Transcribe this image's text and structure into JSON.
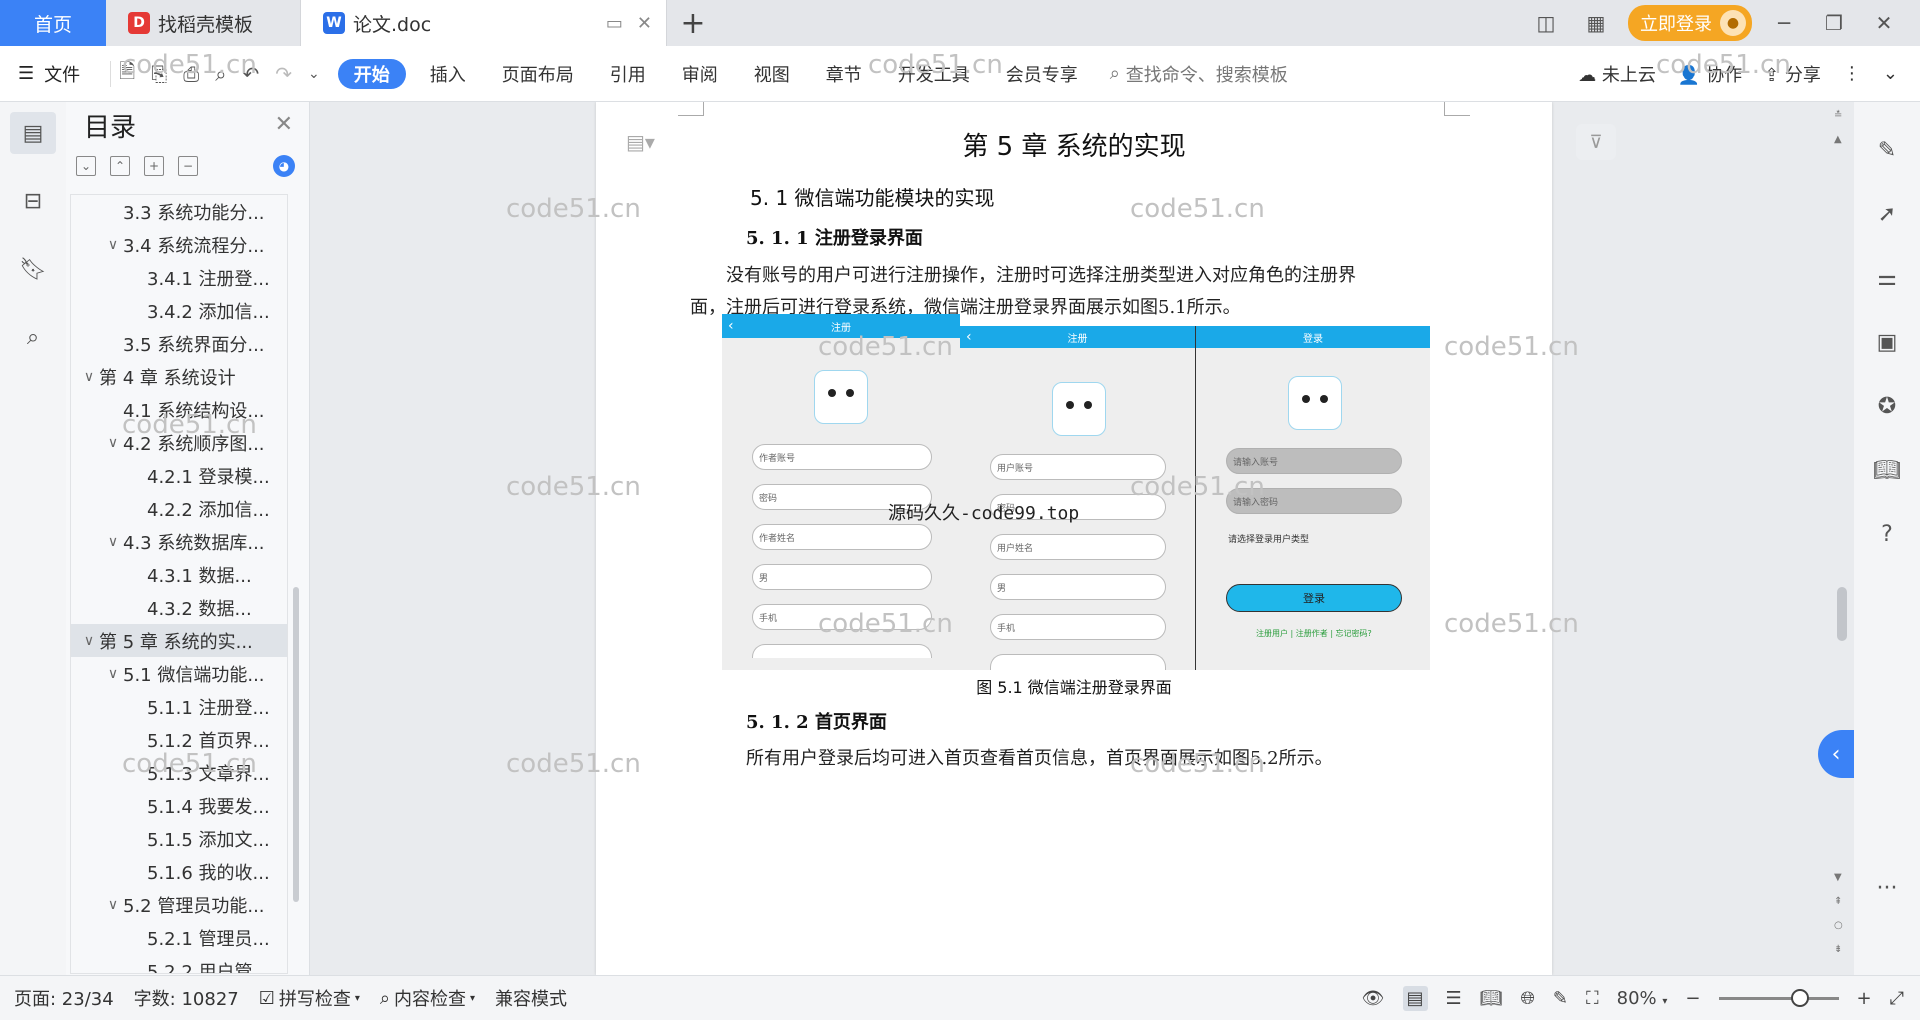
{
  "tabs": {
    "home": "首页",
    "template": "找稻壳模板",
    "doc": "论文.doc",
    "new_tab": "+"
  },
  "titlebar": {
    "login": "立即登录"
  },
  "menu": {
    "file": "文件",
    "tabs": [
      "开始",
      "插入",
      "页面布局",
      "引用",
      "审阅",
      "视图",
      "章节",
      "开发工具",
      "会员专享"
    ],
    "search": "查找命令、搜索模板",
    "cloud": "未上云",
    "collab": "协作",
    "share": "分享"
  },
  "toc": {
    "title": "目录",
    "items": [
      {
        "level": "l2",
        "chev": "",
        "label": "3.3  系统功能分..."
      },
      {
        "level": "l2",
        "chev": "∨",
        "label": "3.4  系统流程分..."
      },
      {
        "level": "l3",
        "chev": "",
        "label": "3.4.1 注册登..."
      },
      {
        "level": "l3",
        "chev": "",
        "label": "3.4.2 添加信..."
      },
      {
        "level": "l2",
        "chev": "",
        "label": "3.5 系统界面分..."
      },
      {
        "level": "l1",
        "chev": "∨",
        "label": "第 4 章    系统设计"
      },
      {
        "level": "l2",
        "chev": "",
        "label": "4.1 系统结构设..."
      },
      {
        "level": "l2",
        "chev": "∨",
        "label": "4.2 系统顺序图..."
      },
      {
        "level": "l3",
        "chev": "",
        "label": "4.2.1 登录模..."
      },
      {
        "level": "l3",
        "chev": "",
        "label": "4.2.2 添加信..."
      },
      {
        "level": "l2",
        "chev": "∨",
        "label": "4.3 系统数据库..."
      },
      {
        "level": "l3",
        "chev": "",
        "label": "4.3.1  数据..."
      },
      {
        "level": "l3",
        "chev": "",
        "label": "4.3.2  数据..."
      },
      {
        "level": "l1",
        "chev": "∨",
        "label": "第 5 章  系统的实...",
        "selected": true
      },
      {
        "level": "l2",
        "chev": "∨",
        "label": "5.1 微信端功能..."
      },
      {
        "level": "l3",
        "chev": "",
        "label": "5.1.1 注册登..."
      },
      {
        "level": "l3",
        "chev": "",
        "label": "5.1.2 首页界..."
      },
      {
        "level": "l3",
        "chev": "",
        "label": "5.1.3 文章界..."
      },
      {
        "level": "l3",
        "chev": "",
        "label": "5.1.4 我要发..."
      },
      {
        "level": "l3",
        "chev": "",
        "label": "5.1.5 添加文..."
      },
      {
        "level": "l3",
        "chev": "",
        "label": "5.1.6 我的收..."
      },
      {
        "level": "l2",
        "chev": "∨",
        "label": "5.2 管理员功能..."
      },
      {
        "level": "l3",
        "chev": "",
        "label": "5.2.1 管理员..."
      },
      {
        "level": "l3",
        "chev": "",
        "label": "5.2.2 用户管..."
      }
    ]
  },
  "document": {
    "chapter_title": "第 5 章  系统的实现",
    "section_title": "5. 1 微信端功能模块的实现",
    "sub1_title": "5. 1. 1 注册登录界面",
    "para1": "没有账号的用户可进行注册操作，注册时可选择注册类型进入对应角色的注册界面，注册后可进行登录系统，微信端注册登录界面展示如图5.1所示。",
    "figure_caption": "图 5.1  微信端注册登录界面",
    "sub2_title": "5. 1. 2 首页界面",
    "para2": "所有用户登录后均可进入首页查看首页信息，首页界面展示如图5.2所示。",
    "inline_watermark": "源码久久-code99.top",
    "phone1": {
      "title": "注册",
      "fields": [
        "作者账号",
        "密码",
        "作者姓名",
        "男",
        "手机",
        ""
      ]
    },
    "phone2": {
      "title": "注册",
      "fields": [
        "用户账号",
        "密码",
        "用户姓名",
        "男",
        "手机",
        ""
      ]
    },
    "phone3": {
      "title": "登录",
      "fields": [
        "请输入账号",
        "请输入密码"
      ],
      "type_hint": "请选择登录用户类型",
      "button": "登录",
      "links": "注册用户 | 注册作者 | 忘记密码?"
    }
  },
  "watermark": "code51.cn",
  "status": {
    "page": "页面: 23/34",
    "words": "字数: 10827",
    "spell": "拼写检查",
    "content_check": "内容检查",
    "compat": "兼容模式",
    "zoom": "80%"
  },
  "colors": {
    "accent": "#3b82f6",
    "login": "#f5a623",
    "wechat_bar": "#1aa9e8"
  }
}
